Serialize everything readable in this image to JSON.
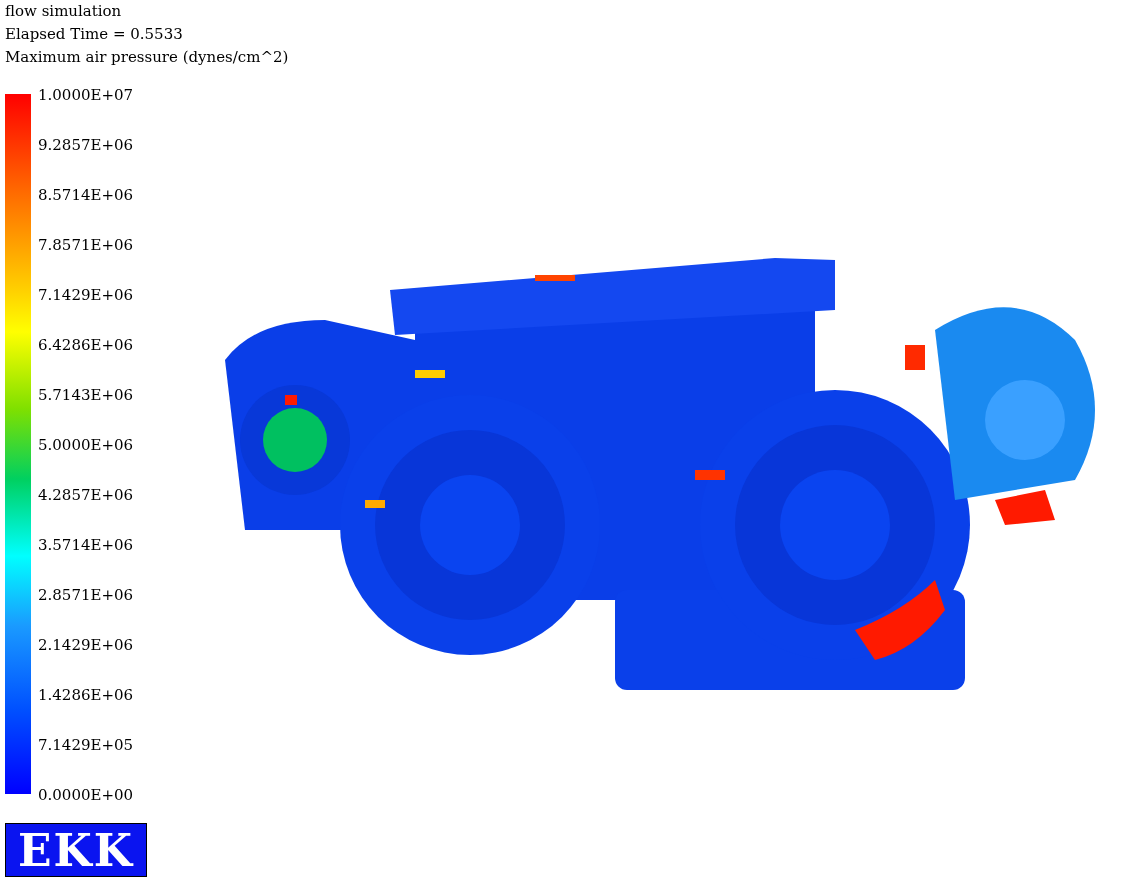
{
  "header": {
    "title": "flow simulation",
    "elapsed_time": "Elapsed Time = 0.5533",
    "quantity": "Maximum air pressure (dynes/cm^2)"
  },
  "legend": {
    "labels": [
      "1.0000E+07",
      "9.2857E+06",
      "8.5714E+06",
      "7.8571E+06",
      "7.1429E+06",
      "6.4286E+06",
      "5.7143E+06",
      "5.0000E+06",
      "4.2857E+06",
      "3.5714E+06",
      "2.8571E+06",
      "2.1429E+06",
      "1.4286E+06",
      "7.1429E+05",
      "0.0000E+00"
    ]
  },
  "logo": {
    "text": "EKK"
  }
}
